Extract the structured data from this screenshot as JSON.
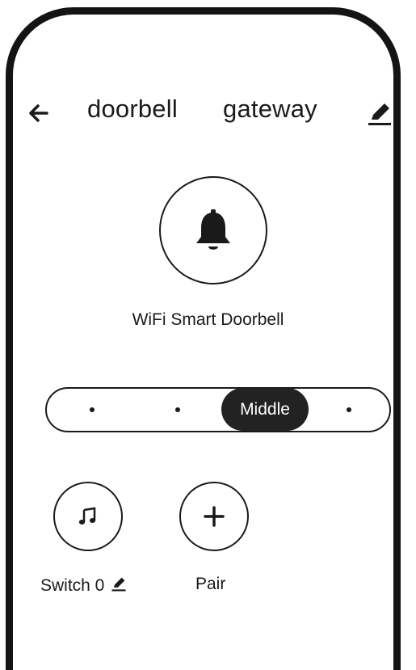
{
  "header": {
    "back_icon": "back-arrow-icon",
    "title_part1": "doorbell",
    "title_part2": "gateway",
    "edit_icon": "pencil-icon"
  },
  "device": {
    "icon": "bell-icon",
    "name": "WiFi Smart Doorbell"
  },
  "volume_selector": {
    "options": [
      "",
      "",
      "Middle",
      ""
    ],
    "selected": "Middle",
    "selected_index": 2
  },
  "actions": [
    {
      "icon": "music-note-icon",
      "label": "Switch 0",
      "label_icon": "pencil-icon"
    },
    {
      "icon": "plus-icon",
      "label": "Pair"
    }
  ],
  "colors": {
    "ink": "#1a1a1a",
    "pill": "#222222",
    "background": "#ffffff"
  }
}
